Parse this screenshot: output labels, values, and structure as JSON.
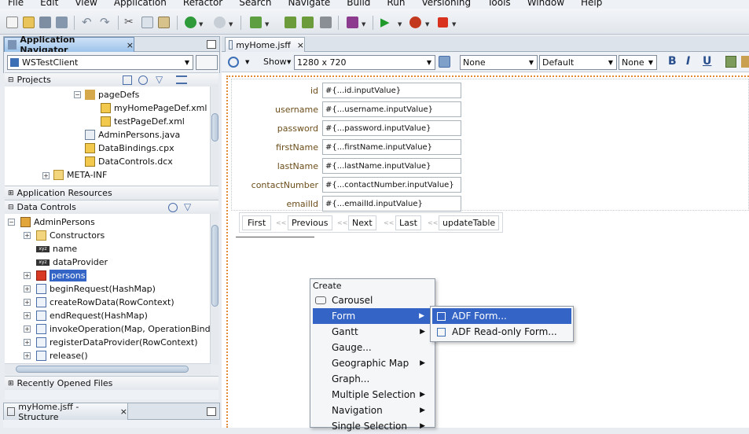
{
  "menubar": [
    "File",
    "Edit",
    "View",
    "Application",
    "Refactor",
    "Search",
    "Navigate",
    "Build",
    "Run",
    "Versioning",
    "Tools",
    "Window",
    "Help"
  ],
  "app_nav": {
    "title": "Application Navigator",
    "close": "×",
    "app": "WSTestClient"
  },
  "projects": {
    "title": "Projects",
    "items": [
      "pageDefs",
      "myHomePageDef.xml",
      "testPageDef.xml",
      "AdminPersons.java",
      "DataBindings.cpx",
      "DataControls.dcx",
      "META-INF"
    ]
  },
  "app_resources": "Application Resources",
  "data_controls": {
    "title": "Data Controls",
    "items": [
      "AdminPersons",
      "Constructors",
      "name",
      "dataProvider",
      "persons",
      "beginRequest(HashMap)",
      "createRowData(RowContext)",
      "endRequest(HashMap)",
      "invokeOperation(Map, OperationBinding)",
      "registerDataProvider(RowContext)",
      "release()"
    ]
  },
  "recent": "Recently Opened Files",
  "structure": {
    "title": "myHome.jsff - Structure",
    "close": "×"
  },
  "editor": {
    "tab": "myHome.jsff",
    "close": "×",
    "show": "Show",
    "size": "1280 x 720",
    "none1": "None",
    "default": "Default",
    "none2": "None",
    "bold": "B",
    "italic": "I",
    "underline": "U"
  },
  "form": {
    "fields": [
      {
        "label": "id",
        "value": "#{...id.inputValue}"
      },
      {
        "label": "username",
        "value": "#{...username.inputValue}"
      },
      {
        "label": "password",
        "value": "#{...password.inputValue}"
      },
      {
        "label": "firstName",
        "value": "#{...firstName.inputValue}"
      },
      {
        "label": "lastName",
        "value": "#{...lastName.inputValue}"
      },
      {
        "label": "contactNumber",
        "value": "#{...contactNumber.inputValue}"
      },
      {
        "label": "emailId",
        "value": "#{...emailId.inputValue}"
      }
    ],
    "buttons": [
      "First",
      "Previous",
      "Next",
      "Last",
      "updateTable"
    ],
    "sep": "<<"
  },
  "context_menu": {
    "header": "Create",
    "items": [
      "Carousel",
      "Form",
      "Gantt",
      "Gauge...",
      "Geographic Map",
      "Graph...",
      "Multiple Selection",
      "Navigation",
      "Single Selection"
    ]
  },
  "submenu": {
    "items": [
      "ADF Form...",
      "ADF Read-only Form..."
    ]
  },
  "colors": {
    "selection": "#3465c6",
    "label": "#6b4e1a"
  }
}
